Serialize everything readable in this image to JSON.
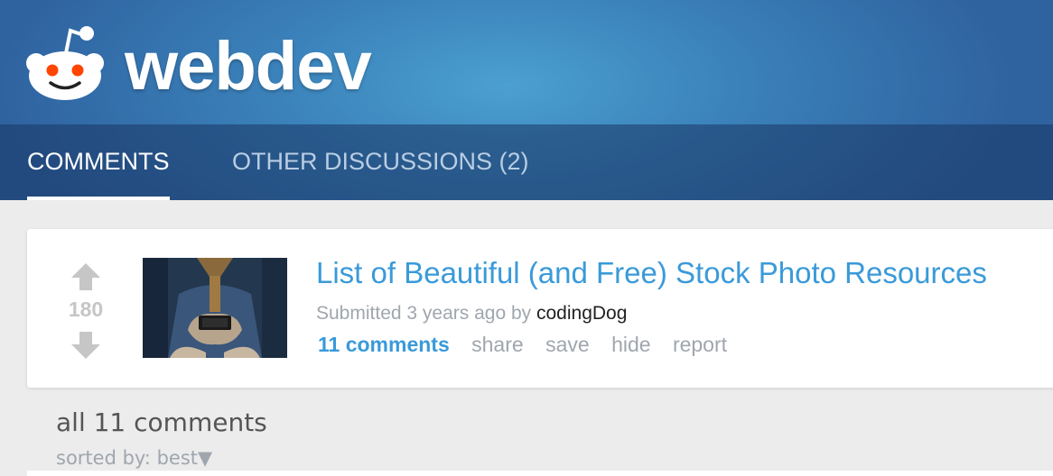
{
  "header": {
    "subreddit_name": "webdev",
    "logo_icon": "reddit-alien-icon",
    "background_color": "#3b82bb"
  },
  "tabs": [
    {
      "label": "COMMENTS",
      "active": true
    },
    {
      "label": "OTHER DISCUSSIONS (2)",
      "active": false
    }
  ],
  "post": {
    "score": "180",
    "upvote_icon": "upvote-arrow-icon",
    "downvote_icon": "downvote-arrow-icon",
    "title": "List of Beautiful (and Free) Stock Photo Resources",
    "submitted_prefix": "Submitted 3 years ago by",
    "author": "codingDog",
    "actions": {
      "comments": "11 comments",
      "share": "share",
      "save": "save",
      "hide": "hide",
      "report": "report"
    },
    "link_color": "#3a9ad9"
  },
  "comments_section": {
    "heading": "all 11 comments",
    "sort_label": "sorted by:",
    "sort_value": "best▼"
  }
}
